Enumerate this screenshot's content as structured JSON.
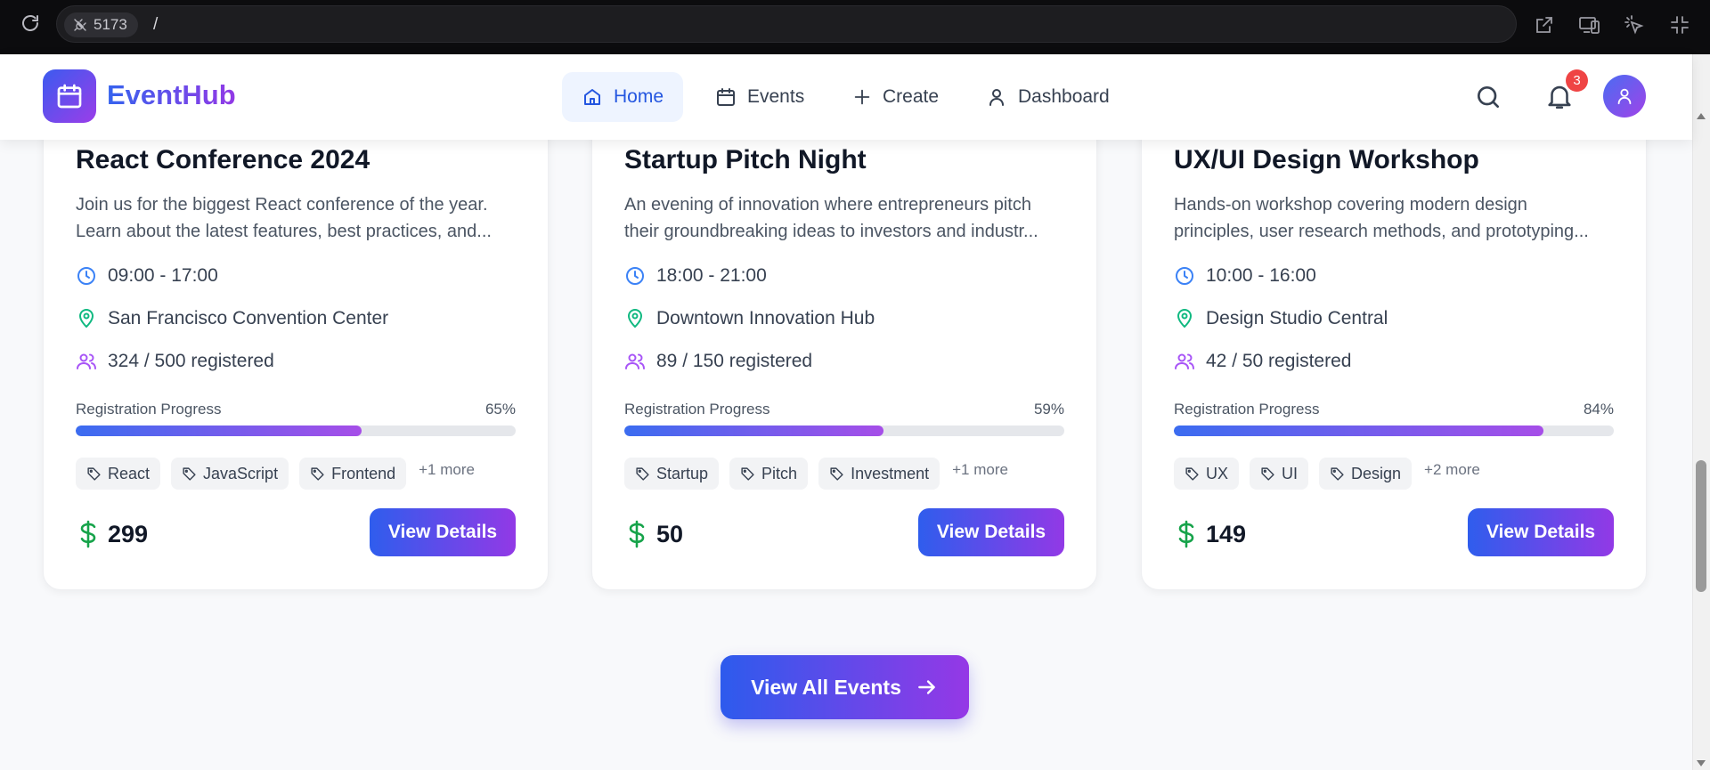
{
  "browser": {
    "port": "5173",
    "path": "/"
  },
  "nav": {
    "brand": "EventHub",
    "items": [
      {
        "label": "Home",
        "icon": "home-icon",
        "active": true
      },
      {
        "label": "Events",
        "icon": "calendar-icon",
        "active": false
      },
      {
        "label": "Create",
        "icon": "plus-icon",
        "active": false
      },
      {
        "label": "Dashboard",
        "icon": "user-icon",
        "active": false
      }
    ],
    "notification_count": "3"
  },
  "events": [
    {
      "title": "React Conference 2024",
      "desc_line1": "Join us for the biggest React conference of the year.",
      "desc_line2": "Learn about the latest features, best practices, and...",
      "time": "09:00 - 17:00",
      "location": "San Francisco Convention Center",
      "registered": "324 / 500 registered",
      "progress_label": "Registration Progress",
      "progress_pct": "65%",
      "progress_value": 0.65,
      "tags": [
        "React",
        "JavaScript",
        "Frontend"
      ],
      "more": "+1 more",
      "price": "299",
      "button": "View Details"
    },
    {
      "title": "Startup Pitch Night",
      "desc_line1": "An evening of innovation where entrepreneurs pitch",
      "desc_line2": "their groundbreaking ideas to investors and industr...",
      "time": "18:00 - 21:00",
      "location": "Downtown Innovation Hub",
      "registered": "89 / 150 registered",
      "progress_label": "Registration Progress",
      "progress_pct": "59%",
      "progress_value": 0.59,
      "tags": [
        "Startup",
        "Pitch",
        "Investment"
      ],
      "more": "+1 more",
      "price": "50",
      "button": "View Details"
    },
    {
      "title": "UX/UI Design Workshop",
      "desc_line1": "Hands-on workshop covering modern design",
      "desc_line2": "principles, user research methods, and prototyping...",
      "time": "10:00 - 16:00",
      "location": "Design Studio Central",
      "registered": "42 / 50 registered",
      "progress_label": "Registration Progress",
      "progress_pct": "84%",
      "progress_value": 0.84,
      "tags": [
        "UX",
        "UI",
        "Design"
      ],
      "more": "+2 more",
      "price": "149",
      "button": "View Details"
    }
  ],
  "view_all": "View All Events",
  "colors": {
    "accent_start": "#2f5ded",
    "accent_end": "#9239e6",
    "clock": "#3b82f6",
    "pin": "#10b981",
    "users": "#a855f7",
    "price_icon": "#16a34a",
    "badge": "#ef4444"
  }
}
